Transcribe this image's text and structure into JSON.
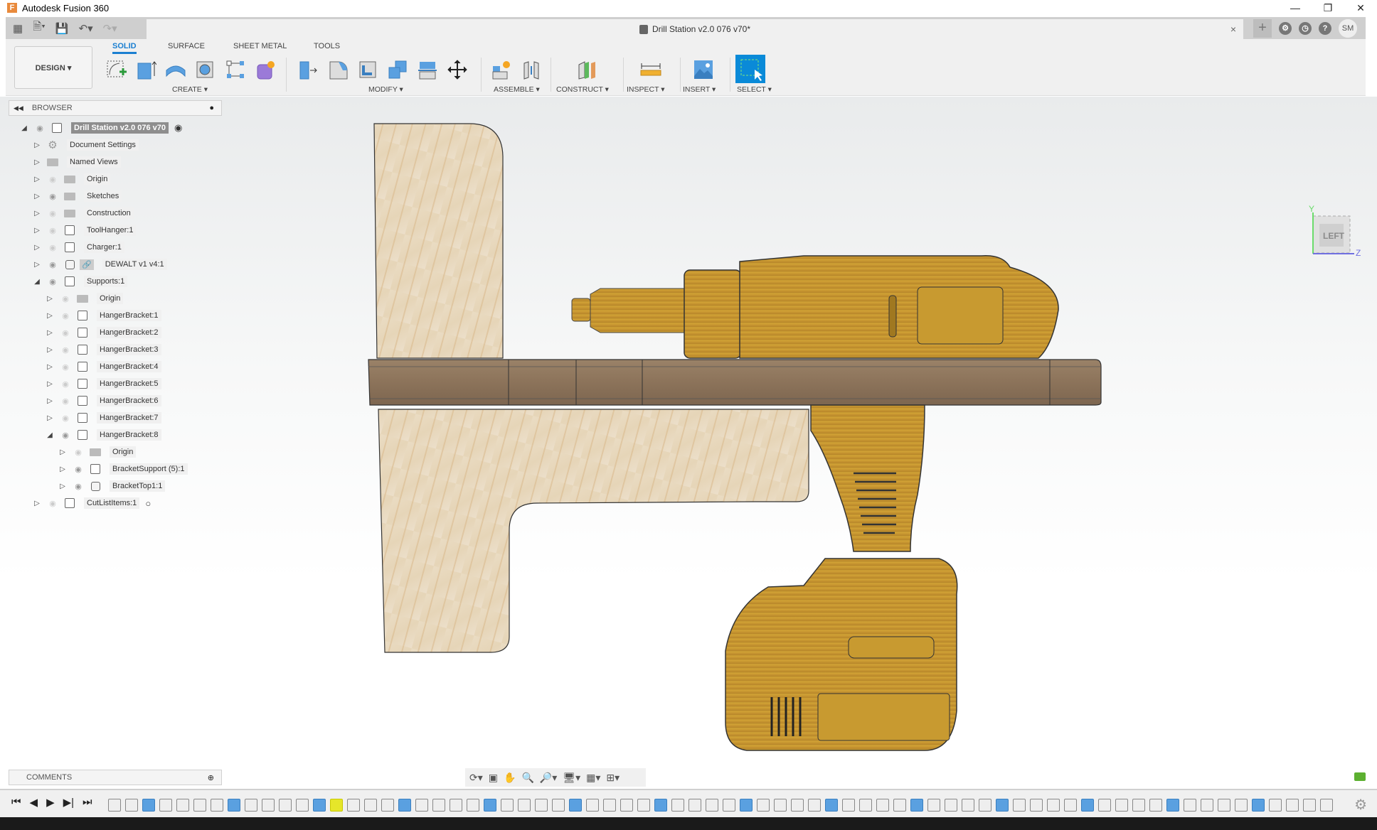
{
  "window": {
    "app_title": "Autodesk Fusion 360",
    "controls": [
      "minimize",
      "maximize",
      "close"
    ]
  },
  "quick_access": {
    "icons": [
      "grid-menu-icon",
      "file-icon",
      "save-icon",
      "undo-icon",
      "redo-icon"
    ]
  },
  "document_tab": {
    "title": "Drill Station v2.0 076 v70*",
    "close_glyph": "×"
  },
  "top_right": {
    "new_tab_glyph": "+",
    "user_initials": "SM",
    "icons": [
      "extensions-icon",
      "job-status-icon",
      "help-icon"
    ]
  },
  "ribbon": {
    "workspace": "DESIGN ▾",
    "tabs": [
      {
        "label": "SOLID",
        "active": true
      },
      {
        "label": "SURFACE",
        "active": false
      },
      {
        "label": "SHEET METAL",
        "active": false
      },
      {
        "label": "TOOLS",
        "active": false
      }
    ],
    "groups": [
      {
        "label": "CREATE ▾",
        "tools": [
          "create-sketch",
          "extrude",
          "revolve",
          "hole",
          "pattern",
          "create-form"
        ]
      },
      {
        "label": "MODIFY ▾",
        "tools": [
          "press-pull",
          "fillet",
          "shell",
          "combine",
          "split-body",
          "move-copy"
        ]
      },
      {
        "label": "ASSEMBLE ▾",
        "tools": [
          "new-component",
          "joint"
        ]
      },
      {
        "label": "CONSTRUCT ▾",
        "tools": [
          "offset-plane"
        ]
      },
      {
        "label": "INSPECT ▾",
        "tools": [
          "measure"
        ]
      },
      {
        "label": "INSERT ▾",
        "tools": [
          "insert-canvas"
        ]
      },
      {
        "label": "SELECT ▾",
        "tools": [
          "select"
        ]
      }
    ]
  },
  "browser": {
    "title": "BROWSER",
    "tree": [
      {
        "label": "Drill Station v2.0 076 v70",
        "depth": 0,
        "expanded": true,
        "visible": true,
        "icon": "component",
        "root": true
      },
      {
        "label": "Document Settings",
        "depth": 1,
        "expanded": false,
        "visible": null,
        "icon": "gear"
      },
      {
        "label": "Named Views",
        "depth": 1,
        "expanded": false,
        "visible": null,
        "icon": "folder"
      },
      {
        "label": "Origin",
        "depth": 1,
        "expanded": false,
        "visible": false,
        "icon": "folder"
      },
      {
        "label": "Sketches",
        "depth": 1,
        "expanded": false,
        "visible": true,
        "icon": "folder"
      },
      {
        "label": "Construction",
        "depth": 1,
        "expanded": false,
        "visible": false,
        "icon": "folder"
      },
      {
        "label": "ToolHanger:1",
        "depth": 1,
        "expanded": false,
        "visible": false,
        "icon": "component"
      },
      {
        "label": "Charger:1",
        "depth": 1,
        "expanded": false,
        "visible": false,
        "icon": "component"
      },
      {
        "label": "DEWALT v1 v4:1",
        "depth": 1,
        "expanded": false,
        "visible": true,
        "icon": "linked-body"
      },
      {
        "label": "Supports:1",
        "depth": 1,
        "expanded": true,
        "visible": true,
        "icon": "component"
      },
      {
        "label": "Origin",
        "depth": 2,
        "expanded": false,
        "visible": false,
        "icon": "folder"
      },
      {
        "label": "HangerBracket:1",
        "depth": 2,
        "expanded": false,
        "visible": false,
        "icon": "component"
      },
      {
        "label": "HangerBracket:2",
        "depth": 2,
        "expanded": false,
        "visible": false,
        "icon": "component"
      },
      {
        "label": "HangerBracket:3",
        "depth": 2,
        "expanded": false,
        "visible": false,
        "icon": "component"
      },
      {
        "label": "HangerBracket:4",
        "depth": 2,
        "expanded": false,
        "visible": false,
        "icon": "component"
      },
      {
        "label": "HangerBracket:5",
        "depth": 2,
        "expanded": false,
        "visible": false,
        "icon": "component"
      },
      {
        "label": "HangerBracket:6",
        "depth": 2,
        "expanded": false,
        "visible": false,
        "icon": "component"
      },
      {
        "label": "HangerBracket:7",
        "depth": 2,
        "expanded": false,
        "visible": false,
        "icon": "component"
      },
      {
        "label": "HangerBracket:8",
        "depth": 2,
        "expanded": true,
        "visible": true,
        "icon": "component"
      },
      {
        "label": "Origin",
        "depth": 3,
        "expanded": false,
        "visible": false,
        "icon": "folder"
      },
      {
        "label": "BracketSupport (5):1",
        "depth": 3,
        "expanded": false,
        "visible": true,
        "icon": "component"
      },
      {
        "label": "BracketTop1:1",
        "depth": 3,
        "expanded": false,
        "visible": true,
        "icon": "body"
      },
      {
        "label": "CutListItems:1",
        "depth": 1,
        "expanded": false,
        "visible": false,
        "icon": "component",
        "radio": true
      }
    ]
  },
  "viewcube": {
    "face": "LEFT",
    "axis_y": "Y",
    "axis_z": "Z"
  },
  "comments": {
    "title": "COMMENTS"
  },
  "navbar": {
    "icons": [
      "orbit-icon",
      "look-at-icon",
      "pan-icon",
      "zoom-icon",
      "fit-icon",
      "display-settings-icon",
      "grid-icon",
      "viewports-icon"
    ]
  },
  "timeline": {
    "controls": [
      "first",
      "previous",
      "play",
      "next",
      "last"
    ],
    "step_count": 72,
    "active_step_index": 13
  },
  "colors": {
    "accent": "#1b7fd1",
    "wood_light": "#e8d9bf",
    "wood_dark": "#8a7259",
    "drill_yellow": "#c99a2e",
    "timeline_active": "#e6e62a"
  }
}
